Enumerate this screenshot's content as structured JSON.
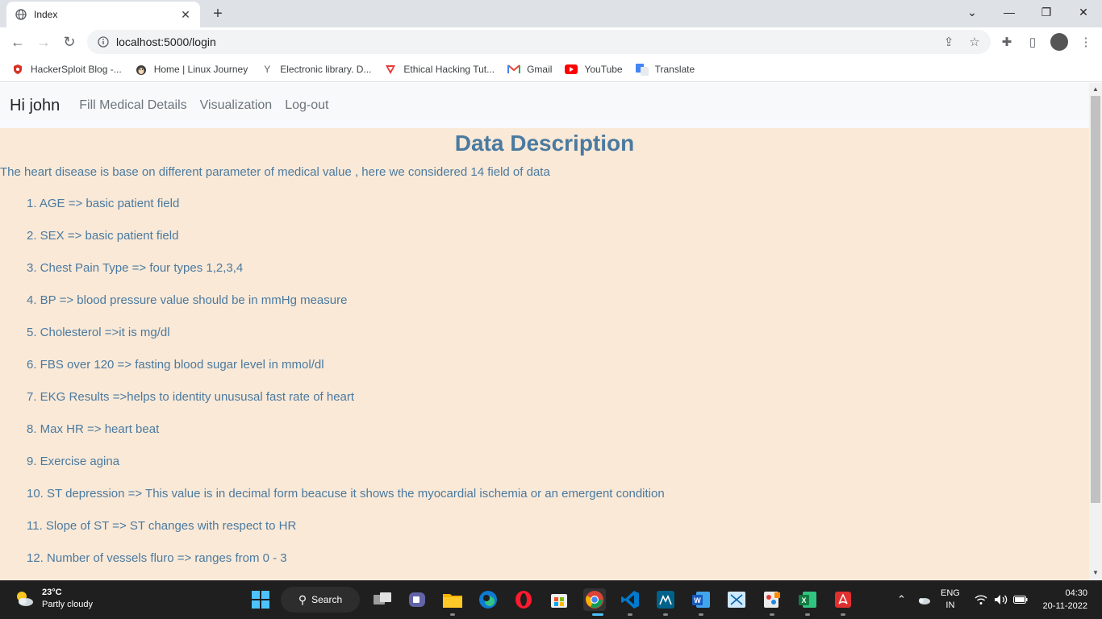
{
  "browser": {
    "tab_title": "Index",
    "url": "localhost:5000/login",
    "bookmarks": [
      {
        "label": "HackerSploit Blog -...",
        "icon": "shield-red-icon"
      },
      {
        "label": "Home | Linux Journey",
        "icon": "penguin-icon"
      },
      {
        "label": "Electronic library. D...",
        "icon": "y-logo-icon"
      },
      {
        "label": "Ethical Hacking Tut...",
        "icon": "red-triangle-icon"
      },
      {
        "label": "Gmail",
        "icon": "gmail-icon"
      },
      {
        "label": "YouTube",
        "icon": "youtube-icon"
      },
      {
        "label": "Translate",
        "icon": "translate-icon"
      }
    ]
  },
  "navbar": {
    "brand": "Hi john",
    "links": [
      "Fill Medical Details",
      "Visualization",
      "Log-out"
    ]
  },
  "content": {
    "heading": "Data Description",
    "intro": "The heart disease is base on different parameter of medical value , here we considered 14 field of data",
    "items": [
      "1. AGE => basic patient field",
      "2. SEX => basic patient field",
      "3. Chest Pain Type => four types 1,2,3,4",
      "4. BP => blood pressure value should be in mmHg measure",
      "5. Cholesterol =>it is mg/dl",
      "6. FBS over 120 => fasting blood sugar level in mmol/dl",
      "7. EKG Results =>helps to identity unususal fast rate of heart",
      "8. Max HR => heart beat",
      "9. Exercise agina",
      "10. ST depression => This value is in decimal form beacuse it shows the myocardial ischemia or an emergent condition",
      "11. Slope of ST => ST changes with respect to HR",
      "12. Number of vessels fluro => ranges from 0 - 3"
    ],
    "colors": {
      "accent": "#4a7aa0",
      "background": "#fae9d7"
    }
  },
  "taskbar": {
    "temperature": "23°C",
    "weather": "Partly cloudy",
    "search_label": "Search",
    "lang_top": "ENG",
    "lang_bottom": "IN",
    "time": "04:30",
    "date": "20-11-2022"
  }
}
